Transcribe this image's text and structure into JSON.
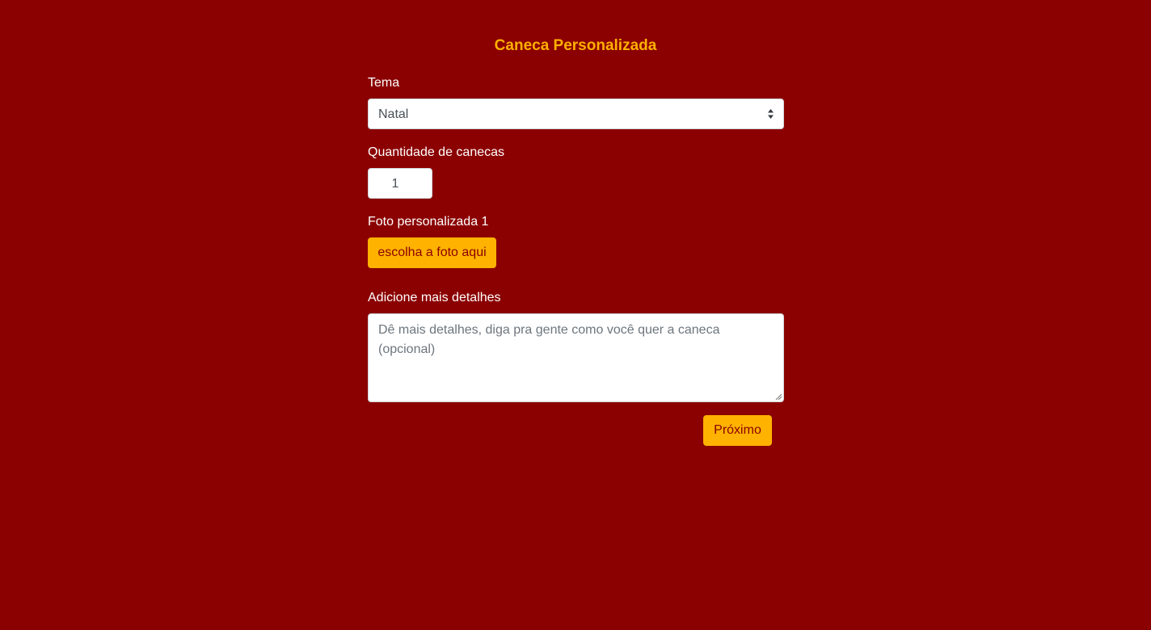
{
  "page": {
    "title": "Caneca Personalizada"
  },
  "form": {
    "theme_label": "Tema",
    "theme_value": "Natal",
    "quantity_label": "Quantidade de canecas",
    "quantity_value": "1",
    "photo_label": "Foto personalizada 1",
    "photo_button": "escolha a foto aqui",
    "details_label": "Adicione mais detalhes",
    "details_placeholder": "Dê mais detalhes, diga pra gente como você quer a caneca (opcional)",
    "details_value": "",
    "next_button": "Próximo"
  },
  "colors": {
    "background": "#8b0000",
    "accent": "#ffb300",
    "title": "#ffb000"
  },
  "icons": {
    "select_arrows": "select-arrows-icon",
    "resize_grip": "resize-grip-icon"
  }
}
